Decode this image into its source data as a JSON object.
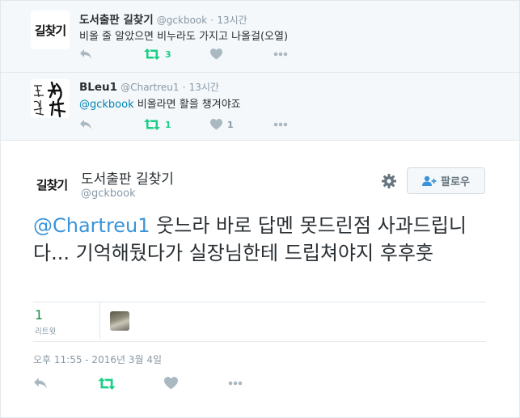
{
  "tweets": [
    {
      "avatar_text": "길찾기",
      "name": "도서출판 길찾기",
      "handle": "@gckbook",
      "dot": "·",
      "time": "13시간",
      "mention": "",
      "text": "비올 줄 알았으면 비누라도 가지고 나올걸(오열)",
      "retweet_count": "3",
      "like_count": ""
    },
    {
      "avatar_text": "",
      "name": "BLeu1",
      "handle": "@Chartreu1",
      "dot": "·",
      "time": "13시간",
      "mention": "@gckbook",
      "text": " 비올라면 활을 챙겨야죠",
      "retweet_count": "1",
      "like_count": "1"
    }
  ],
  "main": {
    "avatar_text": "길찾기",
    "name": "도서출판 길찾기",
    "handle": "@gckbook",
    "follow_label": "팔로우",
    "mention": "@Chartreu1",
    "text": " 웃느라 바로 답멘 못드린점 사과드립니다... 기억해뒀다가 실장님한테 드립쳐야지 후후훗",
    "retweet_count": "1",
    "retweet_label": "리트윗",
    "date": "오후 11:55 - 2016년 3월 4일"
  },
  "icons": {
    "reply": "reply-icon",
    "retweet": "retweet-icon",
    "like": "heart-icon",
    "more": "more-icon",
    "settings": "gear-icon",
    "follow": "add-user-icon"
  },
  "colors": {
    "retweet_green": "#19cf86",
    "icon_grey": "#aab8c2",
    "mention_blue": "#3b94d9",
    "reply_background": "#f5f8fa"
  }
}
